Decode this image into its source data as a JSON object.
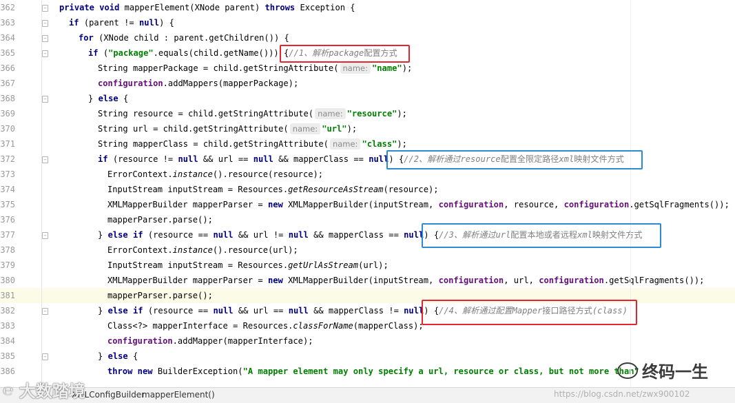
{
  "editor": {
    "lines": [
      {
        "n": "362",
        "indent": 1,
        "segs": [
          [
            "kw",
            "private void "
          ],
          [
            "",
            "mapperElement(XNode parent) "
          ],
          [
            "kw",
            "throws "
          ],
          [
            "",
            "Exception {"
          ]
        ]
      },
      {
        "n": "363",
        "indent": 2,
        "segs": [
          [
            "kw",
            "if "
          ],
          [
            "",
            "(parent != "
          ],
          [
            "kw",
            "null"
          ],
          [
            "",
            ") {"
          ]
        ]
      },
      {
        "n": "364",
        "indent": 3,
        "segs": [
          [
            "kw",
            "for "
          ],
          [
            "",
            "(XNode child : parent.getChildren()) {"
          ]
        ]
      },
      {
        "n": "365",
        "indent": 4,
        "segs": [
          [
            "kw",
            "if "
          ],
          [
            "",
            "("
          ],
          [
            "str",
            "\"package\""
          ],
          [
            "",
            ".equals(child.getName())) {"
          ],
          [
            "cmt",
            "//1、解析"
          ],
          [
            "cmt",
            "package"
          ],
          [
            "cmtcn",
            "配置方式"
          ]
        ]
      },
      {
        "n": "366",
        "indent": 5,
        "segs": [
          [
            "",
            "String mapperPackage = child.getStringAttribute("
          ],
          [
            "hint",
            "name:"
          ],
          [
            "str",
            "\"name\""
          ],
          [
            "",
            ");"
          ]
        ]
      },
      {
        "n": "367",
        "indent": 5,
        "segs": [
          [
            "fld",
            "configuration"
          ],
          [
            "",
            ".addMappers(mapperPackage);"
          ]
        ]
      },
      {
        "n": "368",
        "indent": 4,
        "segs": [
          [
            "",
            "} "
          ],
          [
            "kw",
            "else "
          ],
          [
            "",
            "{"
          ]
        ]
      },
      {
        "n": "369",
        "indent": 5,
        "segs": [
          [
            "",
            "String resource = child.getStringAttribute("
          ],
          [
            "hint",
            "name:"
          ],
          [
            "str",
            "\"resource\""
          ],
          [
            "",
            ");"
          ]
        ]
      },
      {
        "n": "370",
        "indent": 5,
        "segs": [
          [
            "",
            "String url = child.getStringAttribute("
          ],
          [
            "hint",
            "name:"
          ],
          [
            "str",
            "\"url\""
          ],
          [
            "",
            ");"
          ]
        ]
      },
      {
        "n": "371",
        "indent": 5,
        "segs": [
          [
            "",
            "String mapperClass = child.getStringAttribute("
          ],
          [
            "hint",
            "name:"
          ],
          [
            "str",
            "\"class\""
          ],
          [
            "",
            ");"
          ]
        ]
      },
      {
        "n": "372",
        "indent": 5,
        "segs": [
          [
            "kw",
            "if "
          ],
          [
            "",
            "(resource != "
          ],
          [
            "kw",
            "null "
          ],
          [
            "",
            "&& url == "
          ],
          [
            "kw",
            "null "
          ],
          [
            "",
            "&& mapperClass == "
          ],
          [
            "kw",
            "null"
          ],
          [
            "",
            ") {"
          ],
          [
            "cmt",
            "//2、解析通过"
          ],
          [
            "cmt",
            "resource"
          ],
          [
            "cmtcn",
            "配置全限定路径"
          ],
          [
            "cmt",
            "xml"
          ],
          [
            "cmtcn",
            "映射文件方式"
          ]
        ]
      },
      {
        "n": "373",
        "indent": 6,
        "segs": [
          [
            "",
            "ErrorContext."
          ],
          [
            "it",
            "instance"
          ],
          [
            "",
            "().resource(resource);"
          ]
        ]
      },
      {
        "n": "374",
        "indent": 6,
        "segs": [
          [
            "",
            "InputStream inputStream = Resources."
          ],
          [
            "it",
            "getResourceAsStream"
          ],
          [
            "",
            "(resource);"
          ]
        ]
      },
      {
        "n": "375",
        "indent": 6,
        "segs": [
          [
            "",
            "XMLMapperBuilder mapperParser = "
          ],
          [
            "kw",
            "new "
          ],
          [
            "",
            "XMLMapperBuilder(inputStream, "
          ],
          [
            "fld",
            "configuration"
          ],
          [
            "",
            ", resource, "
          ],
          [
            "fld",
            "configuration"
          ],
          [
            "",
            ".getSqlFragments());"
          ]
        ]
      },
      {
        "n": "376",
        "indent": 6,
        "segs": [
          [
            "",
            "mapperParser.parse();"
          ]
        ]
      },
      {
        "n": "377",
        "indent": 5,
        "segs": [
          [
            "",
            "} "
          ],
          [
            "kw",
            "else if "
          ],
          [
            "",
            "(resource == "
          ],
          [
            "kw",
            "null "
          ],
          [
            "",
            "&& url != "
          ],
          [
            "kw",
            "null "
          ],
          [
            "",
            "&& mapperClass == "
          ],
          [
            "kw",
            "null"
          ],
          [
            "",
            ") {"
          ],
          [
            "cmt",
            "//3、解析通过"
          ],
          [
            "cmt",
            "url"
          ],
          [
            "cmtcn",
            "配置本地或者远程"
          ],
          [
            "cmt",
            "xml"
          ],
          [
            "cmtcn",
            "映射文件方式"
          ]
        ]
      },
      {
        "n": "378",
        "indent": 6,
        "segs": [
          [
            "",
            "ErrorContext."
          ],
          [
            "it",
            "instance"
          ],
          [
            "",
            "().resource(url);"
          ]
        ]
      },
      {
        "n": "379",
        "indent": 6,
        "segs": [
          [
            "",
            "InputStream inputStream = Resources."
          ],
          [
            "it",
            "getUrlAsStream"
          ],
          [
            "",
            "(url);"
          ]
        ]
      },
      {
        "n": "380",
        "indent": 6,
        "segs": [
          [
            "",
            "XMLMapperBuilder mapperParser = "
          ],
          [
            "kw",
            "new "
          ],
          [
            "",
            "XMLMapperBuilder(inputStream, "
          ],
          [
            "fld",
            "configuration"
          ],
          [
            "",
            ", url, "
          ],
          [
            "fld",
            "configuration"
          ],
          [
            "",
            ".getSqlFragments());"
          ]
        ]
      },
      {
        "n": "381",
        "indent": 6,
        "hl": true,
        "segs": [
          [
            "",
            "mapperParser.parse();"
          ]
        ]
      },
      {
        "n": "382",
        "indent": 5,
        "segs": [
          [
            "",
            "} "
          ],
          [
            "kw",
            "else if "
          ],
          [
            "",
            "(resource == "
          ],
          [
            "kw",
            "null "
          ],
          [
            "",
            "&& url == "
          ],
          [
            "kw",
            "null "
          ],
          [
            "",
            "&& mapperClass != "
          ],
          [
            "kw",
            "null"
          ],
          [
            "",
            ") {"
          ],
          [
            "cmt",
            "//4、解析通过配置"
          ],
          [
            "cmt",
            "Mapper"
          ],
          [
            "cmtcn",
            "接口路径方式"
          ],
          [
            "cmt",
            "(class)"
          ]
        ]
      },
      {
        "n": "383",
        "indent": 6,
        "segs": [
          [
            "",
            "Class<?> mapperInterface = Resources."
          ],
          [
            "it",
            "classForName"
          ],
          [
            "",
            "(mapperClass);"
          ]
        ]
      },
      {
        "n": "384",
        "indent": 6,
        "segs": [
          [
            "fld",
            "configuration"
          ],
          [
            "",
            ".addMapper(mapperInterface);"
          ]
        ]
      },
      {
        "n": "385",
        "indent": 5,
        "segs": [
          [
            "",
            "} "
          ],
          [
            "kw",
            "else "
          ],
          [
            "",
            "{"
          ]
        ]
      },
      {
        "n": "386",
        "indent": 6,
        "segs": [
          [
            "kw",
            "throw new "
          ],
          [
            "",
            "BuilderException("
          ],
          [
            "str",
            "\"A mapper element may only specify a url, resource or class, but not more than\""
          ]
        ]
      }
    ]
  },
  "breadcrumb": {
    "class_name": "XMLConfigBuilder",
    "method": "mapperElement()",
    "separator": "›"
  },
  "watermarks": {
    "left": "大数踏境",
    "left_logo": "℮",
    "right": "终码一生",
    "url": "https://blog.csdn.net/zwx900102"
  },
  "colors": {
    "keyword": "#000080",
    "string": "#008000",
    "field": "#660e7a",
    "comment": "#808080",
    "annotation_red": "#e4252d",
    "annotation_blue": "#2a8ad4"
  }
}
